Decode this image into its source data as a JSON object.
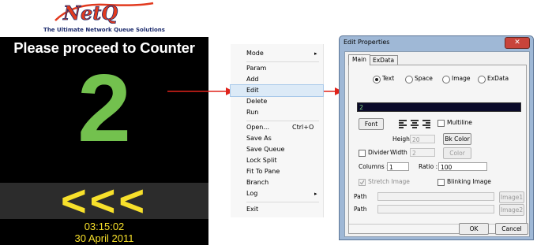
{
  "display": {
    "logo_text": "NetQ",
    "logo_tagline": "The Ultimate Network Queue Solutions",
    "headline": "Please proceed to Counter",
    "counter_number": "2",
    "arrows": "<<<",
    "time": "03:15:02",
    "date": "30 April 2011",
    "colors": {
      "number": "#73c14e",
      "arrows": "#f7e02b",
      "logo_red": "#e23a1f",
      "logo_blue": "#1e2d6e"
    }
  },
  "context_menu": {
    "items": [
      {
        "label": "Mode",
        "submenu": true
      },
      {
        "label": "Param"
      },
      {
        "label": "Add"
      },
      {
        "label": "Edit",
        "highlighted": true
      },
      {
        "label": "Delete"
      },
      {
        "label": "Run"
      },
      {
        "label": "Open...",
        "shortcut": "Ctrl+O"
      },
      {
        "label": "Save As"
      },
      {
        "label": "Save Queue"
      },
      {
        "label": "Lock Split"
      },
      {
        "label": "Fit To Pane"
      },
      {
        "label": "Branch"
      },
      {
        "label": "Log",
        "submenu": true
      },
      {
        "label": "Exit"
      }
    ],
    "submenu_glyph": "▸"
  },
  "dialog": {
    "title": "Edit Properties",
    "close_glyph": "✕",
    "tabs": [
      "Main",
      "ExData"
    ],
    "radios": [
      "Text",
      "Space",
      "Image",
      "ExData"
    ],
    "selected_radio": "Text",
    "text_value": "2",
    "font_button": "Font",
    "multiline_label": "Multiline",
    "height_label": "Height :",
    "height_value": "20",
    "bk_color_button": "Bk Color",
    "divider_label": "Divider",
    "width_label": "Width :",
    "width_value": "2",
    "color_button": "Color",
    "columns_label": "Columns :",
    "columns_value": "1",
    "ratio_label": "Ratio :",
    "ratio_value": "100",
    "stretch_image_label": "Stretch Image",
    "blinking_image_label": "Blinking Image",
    "path_label": "Path",
    "image1_button": "Image1",
    "image2_button": "Image2",
    "ok_button": "OK",
    "cancel_button": "Cancel"
  }
}
